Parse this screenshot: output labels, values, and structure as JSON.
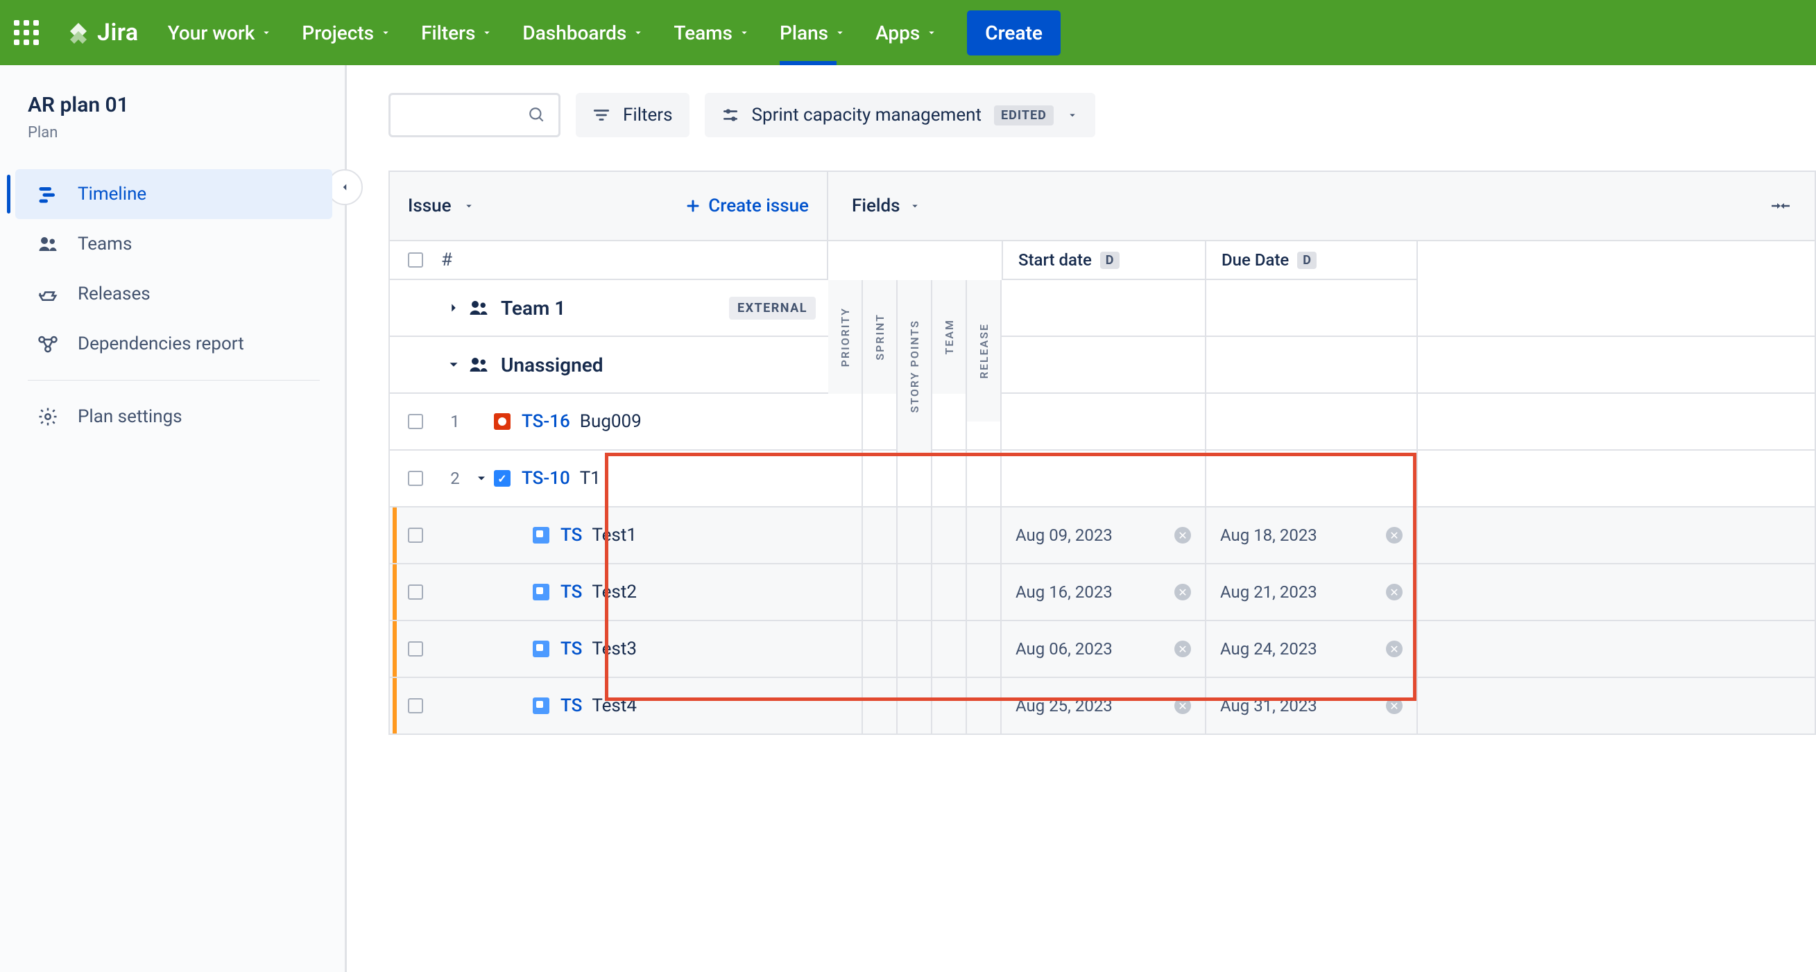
{
  "nav": {
    "logo": "Jira",
    "items": [
      "Your work",
      "Projects",
      "Filters",
      "Dashboards",
      "Teams",
      "Plans",
      "Apps"
    ],
    "active": "Plans",
    "create": "Create"
  },
  "sidebar": {
    "plan_title": "AR plan 01",
    "plan_sub": "Plan",
    "items": [
      {
        "label": "Timeline",
        "icon": "timeline"
      },
      {
        "label": "Teams",
        "icon": "teams"
      },
      {
        "label": "Releases",
        "icon": "releases"
      },
      {
        "label": "Dependencies report",
        "icon": "deps"
      }
    ],
    "settings_label": "Plan settings",
    "active": "Timeline"
  },
  "toolbar": {
    "filters_label": "Filters",
    "view_label": "Sprint capacity management",
    "edited_tag": "EDITED"
  },
  "columns": {
    "issue": "Issue",
    "create_issue": "Create issue",
    "fields": "Fields",
    "hash": "#",
    "mini": [
      "PRIORITY",
      "SPRINT",
      "STORY POINTS",
      "TEAM",
      "RELEASE"
    ],
    "start": "Start date",
    "due": "Due Date",
    "D": "D"
  },
  "groups": [
    {
      "name": "Team 1",
      "badge": "EXTERNAL",
      "expanded": false
    },
    {
      "name": "Unassigned",
      "badge": null,
      "expanded": true
    }
  ],
  "issues": [
    {
      "idx": "1",
      "type": "bug",
      "key": "TS-16",
      "summary": "Bug009",
      "expand": "none",
      "level": 0,
      "start": null,
      "due": null
    },
    {
      "idx": "2",
      "type": "task",
      "key": "TS-10",
      "summary": "T1",
      "expand": "open",
      "level": 0,
      "start": null,
      "due": null
    },
    {
      "idx": "",
      "type": "sub",
      "key": "TS",
      "summary": "Test1",
      "expand": "none",
      "level": 1,
      "start": "Aug 09, 2023",
      "due": "Aug 18, 2023"
    },
    {
      "idx": "",
      "type": "sub",
      "key": "TS",
      "summary": "Test2",
      "expand": "none",
      "level": 1,
      "start": "Aug 16, 2023",
      "due": "Aug 21, 2023"
    },
    {
      "idx": "",
      "type": "sub",
      "key": "TS",
      "summary": "Test3",
      "expand": "none",
      "level": 1,
      "start": "Aug 06, 2023",
      "due": "Aug 24, 2023"
    },
    {
      "idx": "",
      "type": "sub",
      "key": "TS",
      "summary": "Test4",
      "expand": "none",
      "level": 1,
      "start": "Aug 25, 2023",
      "due": "Aug 31, 2023"
    }
  ]
}
